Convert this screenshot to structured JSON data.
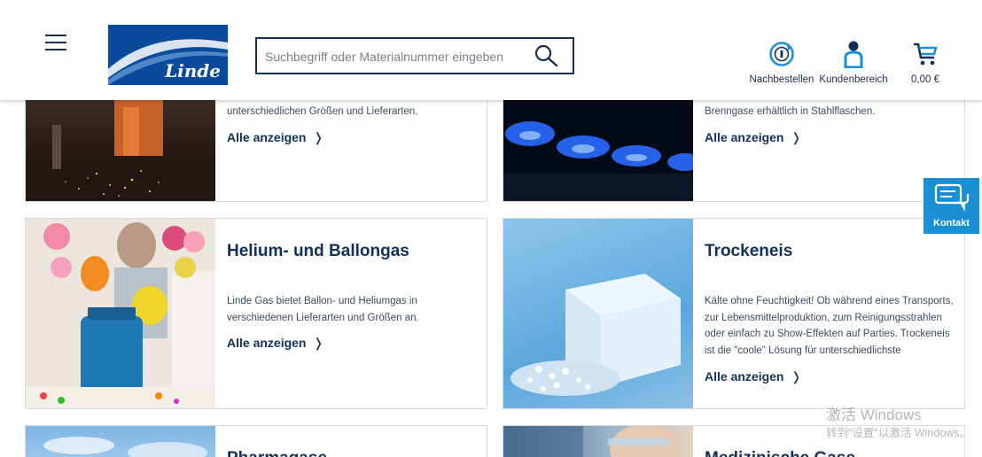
{
  "header": {
    "search": {
      "placeholder": "Suchbegriff oder Materialnummer eingeben",
      "value": ""
    },
    "logo_text": "Linde",
    "items": [
      {
        "label": "Nachbestellen",
        "icon": "reorder-icon"
      },
      {
        "label": "Kundenbereich",
        "icon": "user-icon"
      },
      {
        "label": "0,00 €",
        "icon": "cart-icon"
      }
    ]
  },
  "cards": [
    {
      "title": "",
      "description": "unterschiedlichen Größen und Lieferarten.",
      "link": "Alle anzeigen"
    },
    {
      "title": "",
      "description": "Brenngase erhältlich in Stahlflaschen.",
      "link": "Alle anzeigen"
    },
    {
      "title": "Helium- und Ballongas",
      "description": "Linde Gas bietet Ballon- und Heliumgas in verschiedenen Lieferarten und Größen an.",
      "link": "Alle anzeigen"
    },
    {
      "title": "Trockeneis",
      "description": "Kälte ohne Feuchtigkeit! Ob während eines Transports, zur Lebensmittelproduktion, zum Reinigungsstrahlen oder einfach zu Show-Effekten auf Parties. Trockeneis ist die \"coole\" Lösung für unterschiedlichste",
      "link": "Alle anzeigen"
    },
    {
      "title": "Pharmagase",
      "description": "",
      "link": ""
    },
    {
      "title": "Medizinische Gase",
      "description": "",
      "link": ""
    }
  ],
  "kontakt": {
    "label": "Kontakt"
  },
  "watermark": {
    "line1": "激活 Windows",
    "line2": "转到\"设置\"以激活 Windows。"
  },
  "colors": {
    "brand_blue": "#12305a",
    "logo_blue": "#0a4a9c",
    "kontakt_blue": "#1a8fd6"
  }
}
